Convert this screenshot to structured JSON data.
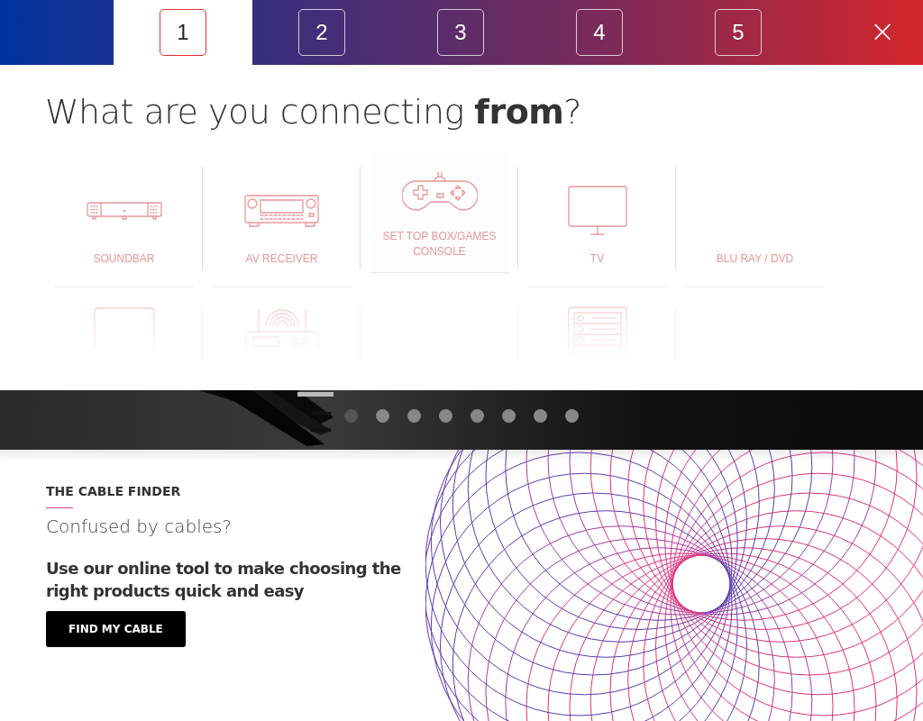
{
  "steps": [
    {
      "label": "1",
      "selected": true
    },
    {
      "label": "2",
      "selected": false
    },
    {
      "label": "3",
      "selected": false
    },
    {
      "label": "4",
      "selected": false
    },
    {
      "label": "5",
      "selected": false
    }
  ],
  "close": {
    "label": "×"
  },
  "heading": "What are you connecting **from**?",
  "devices": [
    {
      "kind": "soundbar",
      "label": "SOUNDBAR",
      "selected": false
    },
    {
      "kind": "receiver",
      "label": "AV RECEIVER",
      "selected": false
    },
    {
      "kind": "gamepad",
      "label": "SET TOP BOX/GAMES CONSOLE",
      "selected": true
    },
    {
      "kind": "tv",
      "label": "TV",
      "selected": false
    },
    {
      "kind": "blank",
      "label": "BLU RAY / DVD",
      "selected": false
    },
    {
      "kind": "tablet"
    },
    {
      "kind": "router"
    },
    {
      "kind": "blank"
    },
    {
      "kind": "server"
    },
    {
      "kind": "blank"
    }
  ],
  "slides": [
    {
      "selected": true
    },
    {
      "selected": false
    },
    {
      "selected": false
    },
    {
      "selected": false
    },
    {
      "selected": false
    },
    {
      "selected": false
    },
    {
      "selected": false
    },
    {
      "selected": false
    }
  ],
  "promo": {
    "eyebrow": "THE CABLE FINDER",
    "title": "Confused by cables?",
    "text": "Use our online tool to make choosing the right products quick and easy",
    "button": "FIND MY CABLE"
  }
}
